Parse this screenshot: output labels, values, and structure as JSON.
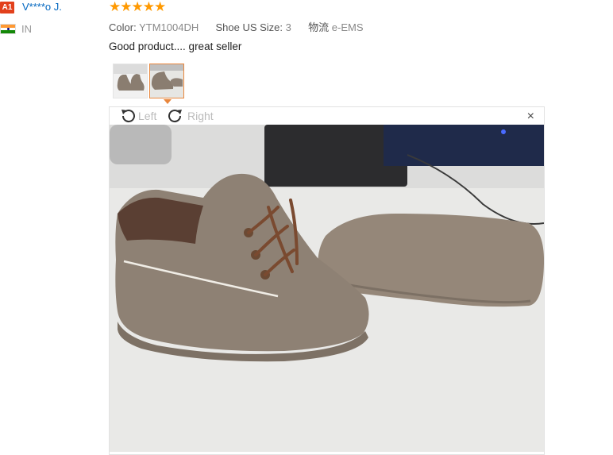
{
  "reviewer": {
    "badge": "A1",
    "name": "V****o J.",
    "country": "IN",
    "flag_icon": "india-flag-icon"
  },
  "review": {
    "rating": 5,
    "stars_text": "★★★★★",
    "star_color": "#ff9900",
    "color_label": "Color:",
    "color_value": "YTM1004DH",
    "size_label": "Shoe US Size:",
    "size_value": "3",
    "logistics_label": "物流",
    "logistics_value": "e-EMS",
    "text": "Good product.... great seller"
  },
  "gallery": {
    "thumbnails": [
      "thumbnail-1",
      "thumbnail-2"
    ],
    "active_index": 1
  },
  "viewer": {
    "rotate_left_label": "Left",
    "rotate_right_label": "Right",
    "close_glyph": "×"
  },
  "colors": {
    "accent": "#e8863c",
    "link": "#0066c0",
    "badge": "#e2401c"
  }
}
